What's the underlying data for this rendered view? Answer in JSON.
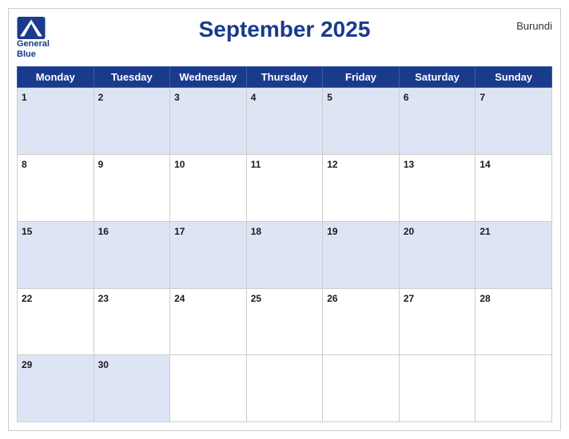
{
  "header": {
    "title": "September 2025",
    "country": "Burundi",
    "logo_line1": "General",
    "logo_line2": "Blue"
  },
  "weekdays": [
    "Monday",
    "Tuesday",
    "Wednesday",
    "Thursday",
    "Friday",
    "Saturday",
    "Sunday"
  ],
  "weeks": [
    [
      {
        "day": 1
      },
      {
        "day": 2
      },
      {
        "day": 3
      },
      {
        "day": 4
      },
      {
        "day": 5
      },
      {
        "day": 6
      },
      {
        "day": 7
      }
    ],
    [
      {
        "day": 8
      },
      {
        "day": 9
      },
      {
        "day": 10
      },
      {
        "day": 11
      },
      {
        "day": 12
      },
      {
        "day": 13
      },
      {
        "day": 14
      }
    ],
    [
      {
        "day": 15
      },
      {
        "day": 16
      },
      {
        "day": 17
      },
      {
        "day": 18
      },
      {
        "day": 19
      },
      {
        "day": 20
      },
      {
        "day": 21
      }
    ],
    [
      {
        "day": 22
      },
      {
        "day": 23
      },
      {
        "day": 24
      },
      {
        "day": 25
      },
      {
        "day": 26
      },
      {
        "day": 27
      },
      {
        "day": 28
      }
    ],
    [
      {
        "day": 29
      },
      {
        "day": 30
      },
      {
        "day": null
      },
      {
        "day": null
      },
      {
        "day": null
      },
      {
        "day": null
      },
      {
        "day": null
      }
    ]
  ]
}
